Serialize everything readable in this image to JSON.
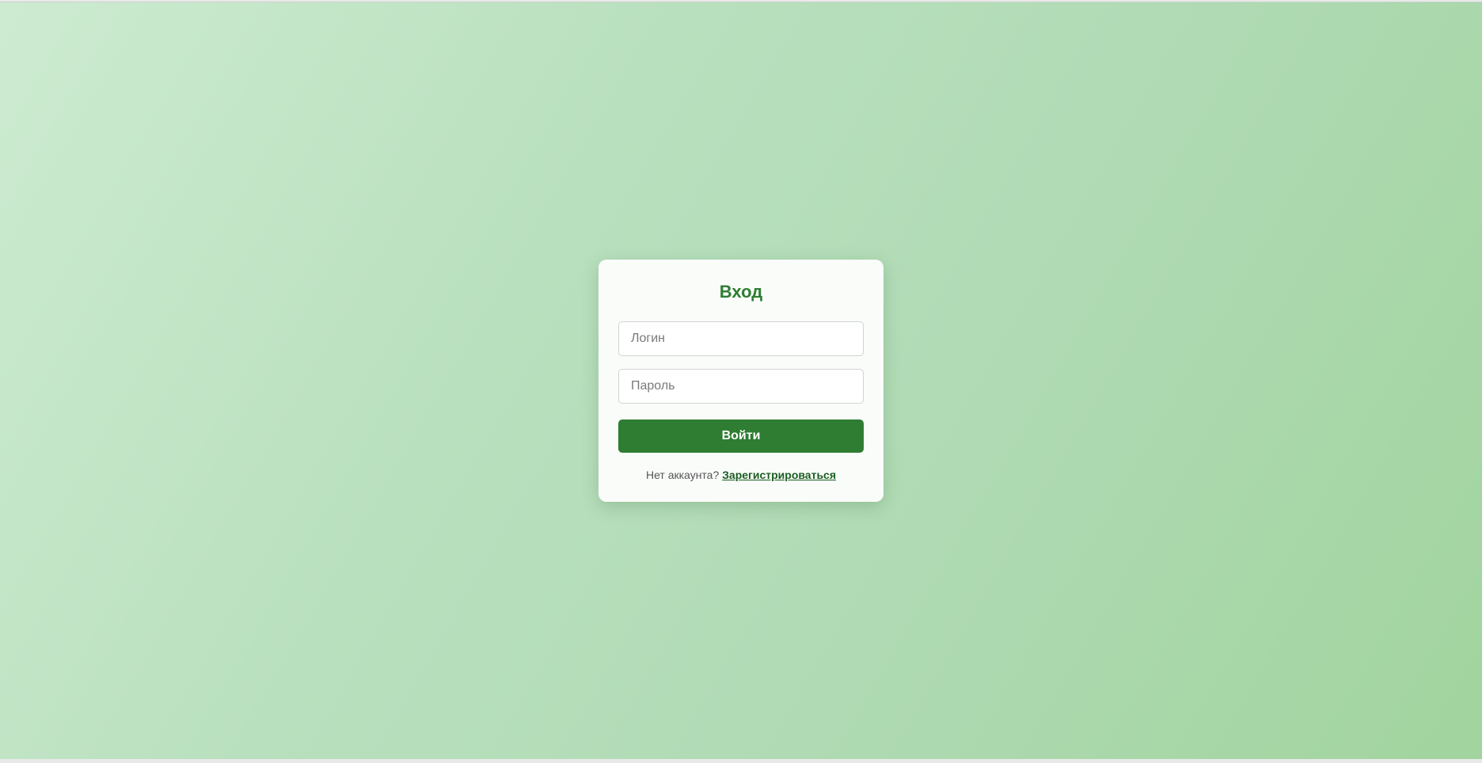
{
  "login_form": {
    "title": "Вход",
    "username": {
      "placeholder": "Логин",
      "value": ""
    },
    "password": {
      "placeholder": "Пароль",
      "value": ""
    },
    "submit_label": "Войти",
    "register_prompt": "Нет аккаунта?",
    "register_link": "Зарегистрироваться"
  },
  "colors": {
    "accent": "#2e7d32",
    "link": "#1b5e20",
    "card_bg": "#fafcfa",
    "bg_start": "#cdebd1",
    "bg_end": "#a1d49e"
  }
}
